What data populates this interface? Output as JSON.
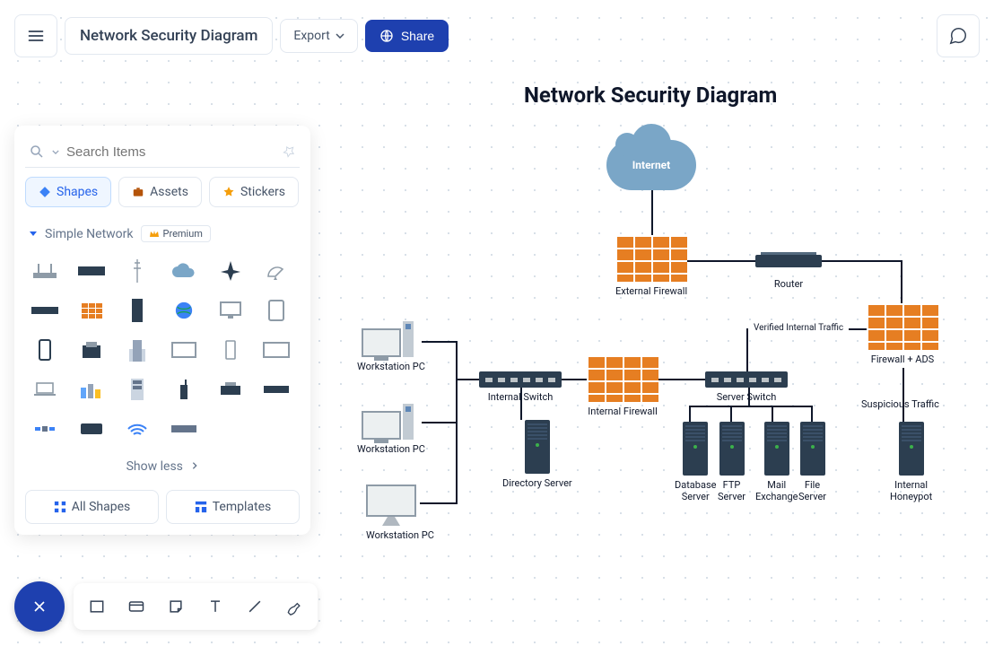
{
  "doc": {
    "title": "Network Security Diagram"
  },
  "toolbar": {
    "export_label": "Export",
    "share_label": "Share"
  },
  "sidebar": {
    "search_placeholder": "Search Items",
    "tabs": [
      {
        "label": "Shapes"
      },
      {
        "label": "Assets"
      },
      {
        "label": "Stickers"
      }
    ],
    "category": {
      "name": "Simple Network",
      "badge": "Premium"
    },
    "show_less": "Show less",
    "all_shapes": "All Shapes",
    "templates": "Templates"
  },
  "diagram": {
    "title": "Network Security Diagram",
    "nodes": {
      "internet": "Internet",
      "external_firewall": "External Firewall",
      "router": "Router",
      "firewall_ads": "Firewall + ADS",
      "verified_traffic": "Verified Internal Traffic",
      "suspicious_traffic": "Suspicious Traffic",
      "server_switch": "Server Switch",
      "internal_switch": "Internal Switch",
      "internal_firewall": "Internal Firewall",
      "directory_server": "Directory Server",
      "database_server": "Database\nServer",
      "ftp_server": "FTP\nServer",
      "mail_exchange": "Mail\nExchange",
      "file_server": "File\nServer",
      "internal_honeypot": "Internal\nHoneypot",
      "workstation_pc_1": "Workstation PC",
      "workstation_pc_2": "Workstation PC",
      "workstation_pc_3": "Workstation PC"
    }
  }
}
